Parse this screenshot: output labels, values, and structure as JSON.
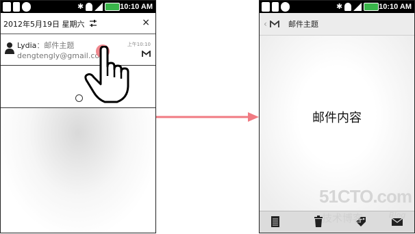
{
  "status_bar": {
    "time": "10:10 AM"
  },
  "left_screen": {
    "date_header": "2012年5月19日 星期六",
    "close_symbol": "×",
    "mail": {
      "sender": "Lydia",
      "separator": "：",
      "subject": "邮件主题",
      "address": "dengtengly@gmail.com",
      "time": "上午10:10"
    }
  },
  "right_screen": {
    "back_symbol": "‹",
    "title": "邮件主题",
    "content": "邮件内容"
  },
  "watermark": {
    "site": "51CTO.com",
    "sub": "技术博客",
    "blog": "Blog"
  },
  "colors": {
    "battery": "#39b54a",
    "tap": "#f07a82",
    "arrow": "#f07a82"
  }
}
